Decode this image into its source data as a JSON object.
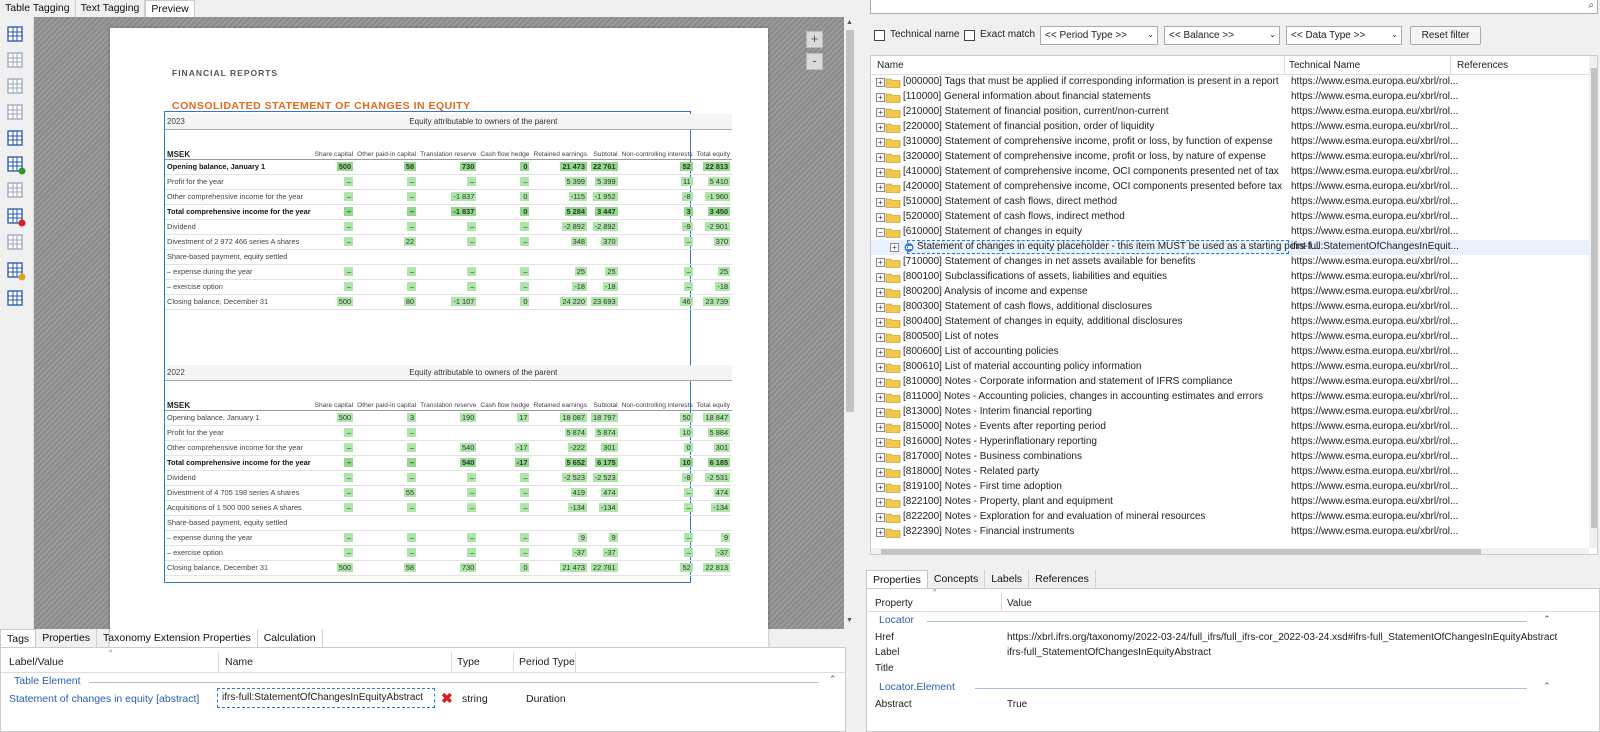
{
  "top_tabs": [
    "Table Tagging",
    "Text Tagging",
    "Preview"
  ],
  "toolbar_icons": [
    "table-select-icon",
    "table-add-icon",
    "table-add-2-icon",
    "table-edit-icon",
    "table-grid-icon",
    "table-add-green-icon",
    "table-settings-icon",
    "table-remove-icon",
    "table-disabled-icon",
    "table-star-icon",
    "table-list-icon"
  ],
  "report": {
    "header": "FINANCIAL REPORTS",
    "title": "CONSOLIDATED STATEMENT OF CHANGES IN EQUITY",
    "columns": [
      "Share capital",
      "Other paid-in capital",
      "Translation reserve",
      "Cash flow hedge",
      "Retained earnings",
      "Subtotal",
      "Non-controlling interests",
      "Total equity"
    ],
    "unit": "MSEK",
    "group_header": "Equity attributable to owners of the parent",
    "tables": [
      {
        "year": "2023",
        "rows": [
          {
            "label": "Opening balance, January 1",
            "bold": true,
            "v": [
              "500",
              "58",
              "730",
              "0",
              "21 473",
              "22 761",
              "52",
              "22 813"
            ]
          },
          {
            "label": "Profit for the year",
            "v": [
              "–",
              "–",
              "–",
              "–",
              "5 399",
              "5 399",
              "11",
              "5 410"
            ]
          },
          {
            "label": "Other comprehensive income for the year",
            "v": [
              "–",
              "–",
              "-1 837",
              "0",
              "-115",
              "-1 952",
              "-8",
              "-1 960"
            ]
          },
          {
            "label": "Total comprehensive income for the year",
            "bold": true,
            "v": [
              "–",
              "–",
              "-1 837",
              "0",
              "5 284",
              "3 447",
              "3",
              "3 450"
            ]
          },
          {
            "label": "Dividend",
            "v": [
              "–",
              "–",
              "–",
              "–",
              "-2 892",
              "-2 892",
              "-9",
              "-2 901"
            ]
          },
          {
            "label": "Divestment of 2 972 466 series A shares",
            "v": [
              "–",
              "22",
              "–",
              "–",
              "348",
              "370",
              "–",
              "370"
            ]
          },
          {
            "label": "Share-based payment, equity settled",
            "v": [
              "",
              "",
              "",
              "",
              "",
              "",
              "",
              ""
            ]
          },
          {
            "label": "– expense during the year",
            "v": [
              "–",
              "–",
              "–",
              "–",
              "25",
              "25",
              "–",
              "25"
            ]
          },
          {
            "label": "– exercise option",
            "v": [
              "–",
              "–",
              "–",
              "–",
              "-18",
              "-18",
              "–",
              "-18"
            ]
          },
          {
            "label": "Closing balance, December 31",
            "v": [
              "500",
              "80",
              "-1 107",
              "0",
              "24 220",
              "23 693",
              "46",
              "23 739"
            ]
          }
        ]
      },
      {
        "year": "2022",
        "rows": [
          {
            "label": "Opening balance, January 1",
            "v": [
              "500",
              "3",
              "190",
              "17",
              "18 087",
              "18 797",
              "50",
              "18 847"
            ]
          },
          {
            "label": "Profit for the year",
            "v": [
              "–",
              "–",
              "",
              "",
              "5 874",
              "5 874",
              "10",
              "5 884"
            ]
          },
          {
            "label": "Other comprehensive income for the year",
            "v": [
              "–",
              "–",
              "540",
              "-17",
              "-222",
              "301",
              "0",
              "301"
            ]
          },
          {
            "label": "Total comprehensive income for the year",
            "bold": true,
            "v": [
              "–",
              "–",
              "540",
              "-17",
              "5 652",
              "6 175",
              "10",
              "6 185"
            ]
          },
          {
            "label": "Dividend",
            "v": [
              "–",
              "–",
              "–",
              "–",
              "-2 523",
              "-2 523",
              "-8",
              "-2 531"
            ]
          },
          {
            "label": "Divestment of 4 705 198 series A shares",
            "v": [
              "–",
              "55",
              "–",
              "–",
              "419",
              "474",
              "–",
              "474"
            ]
          },
          {
            "label": "Acquisitions of 1 500 000 series A shares",
            "v": [
              "–",
              "–",
              "–",
              "–",
              "-134",
              "-134",
              "–",
              "-134"
            ]
          },
          {
            "label": "Share-based payment, equity settled",
            "v": [
              "",
              "",
              "",
              "",
              "",
              "",
              "",
              ""
            ]
          },
          {
            "label": "– expense during the year",
            "v": [
              "–",
              "–",
              "–",
              "–",
              "9",
              "9",
              "–",
              "9"
            ]
          },
          {
            "label": "– exercise option",
            "v": [
              "–",
              "–",
              "–",
              "–",
              "-37",
              "-37",
              "–",
              "-37"
            ]
          },
          {
            "label": "Closing balance, December 31",
            "v": [
              "500",
              "58",
              "730",
              "0",
              "21 473",
              "22 761",
              "52",
              "22 813"
            ]
          }
        ]
      }
    ]
  },
  "bottom_left": {
    "tabs": [
      "Tags",
      "Properties",
      "Taxonomy Extension Properties",
      "Calculation"
    ],
    "columns": [
      "Label/Value",
      "Name",
      "Type",
      "Period Type"
    ],
    "group": "Table Element",
    "row": {
      "label": "Statement of changes in equity [abstract]",
      "name": "ifrs-full:StatementOfChangesInEquityAbstract",
      "type": "string",
      "period": "Duration"
    }
  },
  "filters": {
    "technical_name": "Technical name",
    "exact_match": "Exact match",
    "period_type": "<< Period Type >>",
    "balance": "<< Balance >>",
    "data_type": "<< Data Type >>",
    "reset": "Reset filter"
  },
  "tree": {
    "columns": [
      "Name",
      "Technical Name",
      "References"
    ],
    "rows": [
      {
        "name": "[000000] Tags that must be applied if corresponding information is present in a report",
        "tn": "https://www.esma.europa.eu/xbrl/rol..."
      },
      {
        "name": "[110000] General information about financial statements",
        "tn": "https://www.esma.europa.eu/xbrl/rol..."
      },
      {
        "name": "[210000] Statement of financial position, current/non-current",
        "tn": "https://www.esma.europa.eu/xbrl/rol..."
      },
      {
        "name": "[220000] Statement of financial position, order of liquidity",
        "tn": "https://www.esma.europa.eu/xbrl/rol..."
      },
      {
        "name": "[310000] Statement of comprehensive income, profit or loss, by function of expense",
        "tn": "https://www.esma.europa.eu/xbrl/rol..."
      },
      {
        "name": "[320000] Statement of comprehensive income, profit or loss, by nature of expense",
        "tn": "https://www.esma.europa.eu/xbrl/rol..."
      },
      {
        "name": "[410000] Statement of comprehensive income, OCI components presented net of tax",
        "tn": "https://www.esma.europa.eu/xbrl/rol..."
      },
      {
        "name": "[420000] Statement of comprehensive income, OCI components presented before tax",
        "tn": "https://www.esma.europa.eu/xbrl/rol..."
      },
      {
        "name": "[510000] Statement of cash flows, direct method",
        "tn": "https://www.esma.europa.eu/xbrl/rol..."
      },
      {
        "name": "[520000] Statement of cash flows, indirect method",
        "tn": "https://www.esma.europa.eu/xbrl/rol..."
      },
      {
        "name": "[610000] Statement of changes in equity",
        "tn": "https://www.esma.europa.eu/xbrl/rol...",
        "expanded": true
      },
      {
        "name": "Statement of changes in equity placeholder - this item MUST be used as a starting point f...",
        "tn": "ifrs-full:StatementOfChangesInEquit...",
        "child": true,
        "selected": true
      },
      {
        "name": "[710000] Statement of changes in net assets available for benefits",
        "tn": "https://www.esma.europa.eu/xbrl/rol..."
      },
      {
        "name": "[800100] Subclassifications of assets, liabilities and equities",
        "tn": "https://www.esma.europa.eu/xbrl/rol..."
      },
      {
        "name": "[800200] Analysis of income and expense",
        "tn": "https://www.esma.europa.eu/xbrl/rol..."
      },
      {
        "name": "[800300] Statement of cash flows, additional disclosures",
        "tn": "https://www.esma.europa.eu/xbrl/rol..."
      },
      {
        "name": "[800400] Statement of changes in equity, additional disclosures",
        "tn": "https://www.esma.europa.eu/xbrl/rol..."
      },
      {
        "name": "[800500] List of notes",
        "tn": "https://www.esma.europa.eu/xbrl/rol..."
      },
      {
        "name": "[800600] List of accounting policies",
        "tn": "https://www.esma.europa.eu/xbrl/rol..."
      },
      {
        "name": "[800610] List of material accounting policy information",
        "tn": "https://www.esma.europa.eu/xbrl/rol..."
      },
      {
        "name": "[810000] Notes - Corporate information and statement of IFRS compliance",
        "tn": "https://www.esma.europa.eu/xbrl/rol..."
      },
      {
        "name": "[811000] Notes - Accounting policies, changes in accounting estimates and errors",
        "tn": "https://www.esma.europa.eu/xbrl/rol..."
      },
      {
        "name": "[813000] Notes - Interim financial reporting",
        "tn": "https://www.esma.europa.eu/xbrl/rol..."
      },
      {
        "name": "[815000] Notes - Events after reporting period",
        "tn": "https://www.esma.europa.eu/xbrl/rol..."
      },
      {
        "name": "[816000] Notes - Hyperinflationary reporting",
        "tn": "https://www.esma.europa.eu/xbrl/rol..."
      },
      {
        "name": "[817000] Notes - Business combinations",
        "tn": "https://www.esma.europa.eu/xbrl/rol..."
      },
      {
        "name": "[818000] Notes - Related party",
        "tn": "https://www.esma.europa.eu/xbrl/rol..."
      },
      {
        "name": "[819100] Notes - First time adoption",
        "tn": "https://www.esma.europa.eu/xbrl/rol..."
      },
      {
        "name": "[822100] Notes - Property, plant and equipment",
        "tn": "https://www.esma.europa.eu/xbrl/rol..."
      },
      {
        "name": "[822200] Notes - Exploration for and evaluation of mineral resources",
        "tn": "https://www.esma.europa.eu/xbrl/rol..."
      },
      {
        "name": "[822390] Notes - Financial instruments",
        "tn": "https://www.esma.europa.eu/xbrl/rol..."
      }
    ]
  },
  "right_bottom": {
    "tabs": [
      "Properties",
      "Concepts",
      "Labels",
      "References"
    ],
    "columns": [
      "Property",
      "Value"
    ],
    "sections": [
      {
        "title": "Locator",
        "rows": [
          {
            "k": "Href",
            "v": "https://xbrl.ifrs.org/taxonomy/2022-03-24/full_ifrs/full_ifrs-cor_2022-03-24.xsd#ifrs-full_StatementOfChangesInEquityAbstract"
          },
          {
            "k": "Label",
            "v": "ifrs-full_StatementOfChangesInEquityAbstract"
          },
          {
            "k": "Title",
            "v": ""
          }
        ]
      },
      {
        "title": "Locator.Element",
        "rows": [
          {
            "k": "Abstract",
            "v": "True"
          }
        ]
      }
    ]
  },
  "colors": {
    "accent": "#2a78d8",
    "orange": "#e36a1a",
    "highlight": "#aee6a9"
  }
}
